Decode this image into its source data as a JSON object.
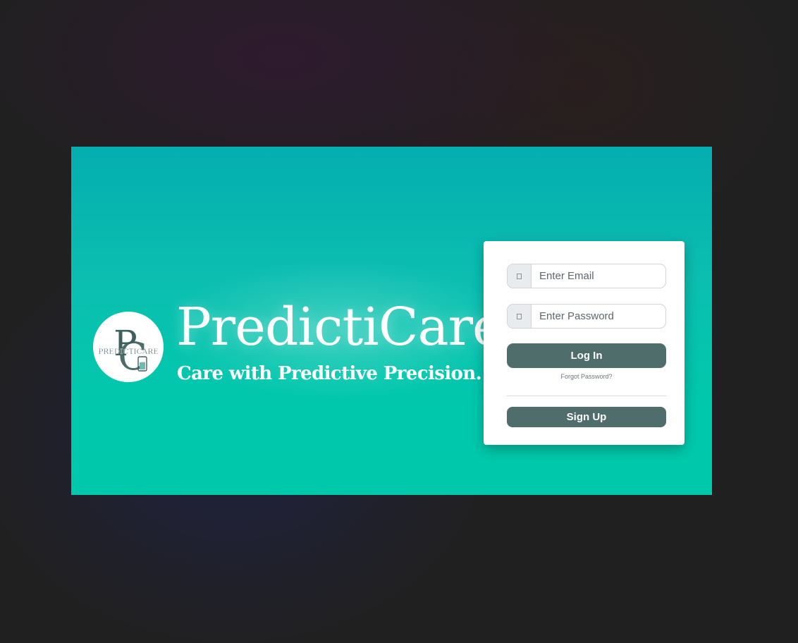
{
  "brand": {
    "name": "PredictiCare",
    "tagline": "Care with Predictive Precision.",
    "logo_text": "PREDICTICARE",
    "logo_monogram_p": "P",
    "logo_monogram_c": "C"
  },
  "login": {
    "email_placeholder": "Enter Email",
    "password_placeholder": "Enter Password",
    "login_label": "Log In",
    "forgot_label": "Forgot Password?",
    "signup_label": "Sign Up",
    "email_icon": "missing-glyph-icon",
    "password_icon": "missing-glyph-icon"
  },
  "colors": {
    "hero_top": "#05aeb0",
    "hero_bottom": "#00c9ab",
    "button": "#4f6d6b",
    "logo_mark": "#3e5f5d"
  }
}
